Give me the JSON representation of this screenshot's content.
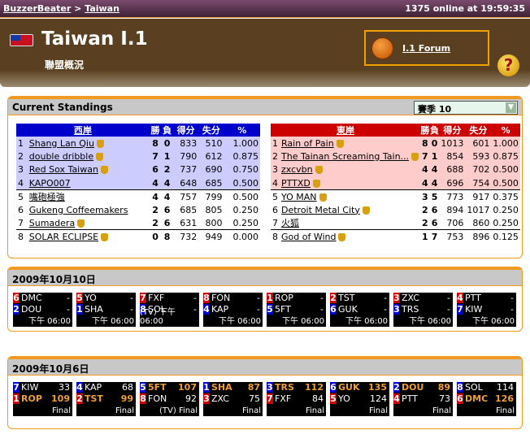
{
  "topbar": {
    "site": "BuzzerBeater",
    "sep": ">",
    "country": "Taiwan",
    "online": "1375 online at 19:59:35"
  },
  "header": {
    "title": "Taiwan I.1",
    "subtitle": "聯盟概況",
    "forum": "I.1 Forum",
    "help": "?"
  },
  "standings": {
    "title": "Current Standings",
    "season": "賽季 10",
    "columns": [
      "勝",
      "負",
      "得分",
      "失分",
      "%"
    ],
    "west": {
      "name": "西岸",
      "color": "#0000cc",
      "highlight": "#ccccff",
      "rows": [
        [
          "1",
          "Shang Lan Qiu",
          true,
          "8",
          "0",
          "833",
          "510",
          "1.000"
        ],
        [
          "2",
          "double dribble",
          true,
          "7",
          "1",
          "790",
          "612",
          "0.875"
        ],
        [
          "3",
          "Red Sox Taiwan",
          true,
          "6",
          "2",
          "737",
          "690",
          "0.750"
        ],
        [
          "4",
          "KAPO007",
          false,
          "4",
          "4",
          "648",
          "685",
          "0.500"
        ],
        [
          "5",
          "嘴砲極強",
          false,
          "4",
          "4",
          "757",
          "799",
          "0.500"
        ],
        [
          "6",
          "Gukeng Coffeemakers",
          false,
          "2",
          "6",
          "685",
          "805",
          "0.250"
        ],
        [
          "7",
          "Sumadera",
          true,
          "2",
          "6",
          "631",
          "800",
          "0.250"
        ],
        [
          "8",
          "SOLAR ECLIPSE",
          true,
          "0",
          "8",
          "732",
          "949",
          "0.000"
        ]
      ]
    },
    "east": {
      "name": "東岸",
      "color": "#cc0000",
      "highlight": "#ffcccc",
      "rows": [
        [
          "1",
          "Rain of Pain",
          true,
          "8",
          "0",
          "1013",
          "601",
          "1.000"
        ],
        [
          "2",
          "The Tainan Screaming Tain...",
          true,
          "7",
          "1",
          "854",
          "593",
          "0.875"
        ],
        [
          "3",
          "zxcvbn",
          true,
          "4",
          "4",
          "688",
          "702",
          "0.500"
        ],
        [
          "4",
          "PTTXD",
          true,
          "4",
          "4",
          "696",
          "754",
          "0.500"
        ],
        [
          "5",
          "YO MAN",
          true,
          "3",
          "5",
          "773",
          "917",
          "0.375"
        ],
        [
          "6",
          "Detroit Metal City",
          true,
          "2",
          "6",
          "894",
          "1017",
          "0.250"
        ],
        [
          "7",
          "火狐",
          false,
          "2",
          "6",
          "706",
          "860",
          "0.250"
        ],
        [
          "8",
          "God of Wind",
          true,
          "1",
          "7",
          "753",
          "896",
          "0.125"
        ]
      ]
    }
  },
  "colors": {
    "E": "#cc0000",
    "W": "#0000cc"
  },
  "upcoming": {
    "date": "2009年10月10日",
    "games": [
      {
        "a": [
          "6",
          "E",
          "DMC",
          "-"
        ],
        "b": [
          "2",
          "W",
          "DOU",
          "-"
        ],
        "foot": "下午 06:00"
      },
      {
        "a": [
          "5",
          "E",
          "YO",
          "-"
        ],
        "b": [
          "1",
          "W",
          "SHA",
          "-"
        ],
        "foot": "下午 06:00"
      },
      {
        "a": [
          "7",
          "E",
          "FXF",
          "-"
        ],
        "b": [
          "8",
          "W",
          "SOL",
          "-"
        ],
        "foot": "(TV) 下午 06:00"
      },
      {
        "a": [
          "8",
          "E",
          "FON",
          "-"
        ],
        "b": [
          "4",
          "W",
          "KAP",
          "-"
        ],
        "foot": "下午 06:00"
      },
      {
        "a": [
          "1",
          "E",
          "ROP",
          "-"
        ],
        "b": [
          "5",
          "W",
          "5FT",
          "-"
        ],
        "foot": "下午 06:00"
      },
      {
        "a": [
          "2",
          "E",
          "TST",
          "-"
        ],
        "b": [
          "6",
          "W",
          "GUK",
          "-"
        ],
        "foot": "下午 06:00"
      },
      {
        "a": [
          "3",
          "E",
          "ZXC",
          "-"
        ],
        "b": [
          "3",
          "W",
          "TRS",
          "-"
        ],
        "foot": "下午 06:00"
      },
      {
        "a": [
          "4",
          "E",
          "PTT",
          "-"
        ],
        "b": [
          "7",
          "W",
          "KIW",
          "-"
        ],
        "foot": "下午 06:00"
      }
    ]
  },
  "results": {
    "date": "2009年10月6日",
    "games": [
      {
        "a": [
          "7",
          "W",
          "KIW",
          "33",
          false
        ],
        "b": [
          "1",
          "E",
          "ROP",
          "109",
          true
        ],
        "foot": "Final"
      },
      {
        "a": [
          "4",
          "W",
          "KAP",
          "68",
          false
        ],
        "b": [
          "2",
          "E",
          "TST",
          "99",
          true
        ],
        "foot": "Final"
      },
      {
        "a": [
          "5",
          "W",
          "5FT",
          "107",
          true
        ],
        "b": [
          "8",
          "E",
          "FON",
          "92",
          false
        ],
        "foot": "(TV) Final"
      },
      {
        "a": [
          "1",
          "W",
          "SHA",
          "87",
          true
        ],
        "b": [
          "3",
          "E",
          "ZXC",
          "75",
          false
        ],
        "foot": "Final"
      },
      {
        "a": [
          "3",
          "W",
          "TRS",
          "112",
          true
        ],
        "b": [
          "7",
          "E",
          "FXF",
          "84",
          false
        ],
        "foot": "Final"
      },
      {
        "a": [
          "6",
          "W",
          "GUK",
          "135",
          true
        ],
        "b": [
          "5",
          "E",
          "YO",
          "124",
          false
        ],
        "foot": "Final"
      },
      {
        "a": [
          "2",
          "W",
          "DOU",
          "89",
          true
        ],
        "b": [
          "4",
          "E",
          "PTT",
          "73",
          false
        ],
        "foot": "Final"
      },
      {
        "a": [
          "8",
          "W",
          "SOL",
          "114",
          false
        ],
        "b": [
          "6",
          "E",
          "DMC",
          "126",
          true
        ],
        "foot": "Final"
      }
    ]
  }
}
